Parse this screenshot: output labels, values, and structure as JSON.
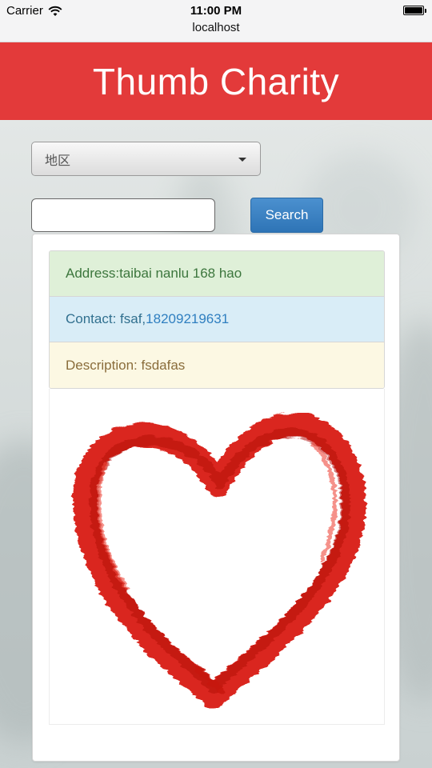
{
  "status_bar": {
    "carrier": "Carrier",
    "time": "11:00 PM",
    "url": "localhost",
    "battery_level": 1.0
  },
  "header": {
    "title": "Thumb Charity",
    "color": "#e33a3a"
  },
  "filters": {
    "region_select": {
      "selected": "地区"
    },
    "search": {
      "value": "",
      "placeholder": ""
    },
    "search_button_label": "Search",
    "search_button_color": "#337ab7"
  },
  "result": {
    "address": "Address:taibai nanlu 168 hao",
    "contact_prefix": "Contact: fsaf,",
    "contact_phone": "18209219631",
    "description": "Description: fsdafas",
    "image_icon": "red-painted-heart",
    "image_color": "#d81d16"
  }
}
